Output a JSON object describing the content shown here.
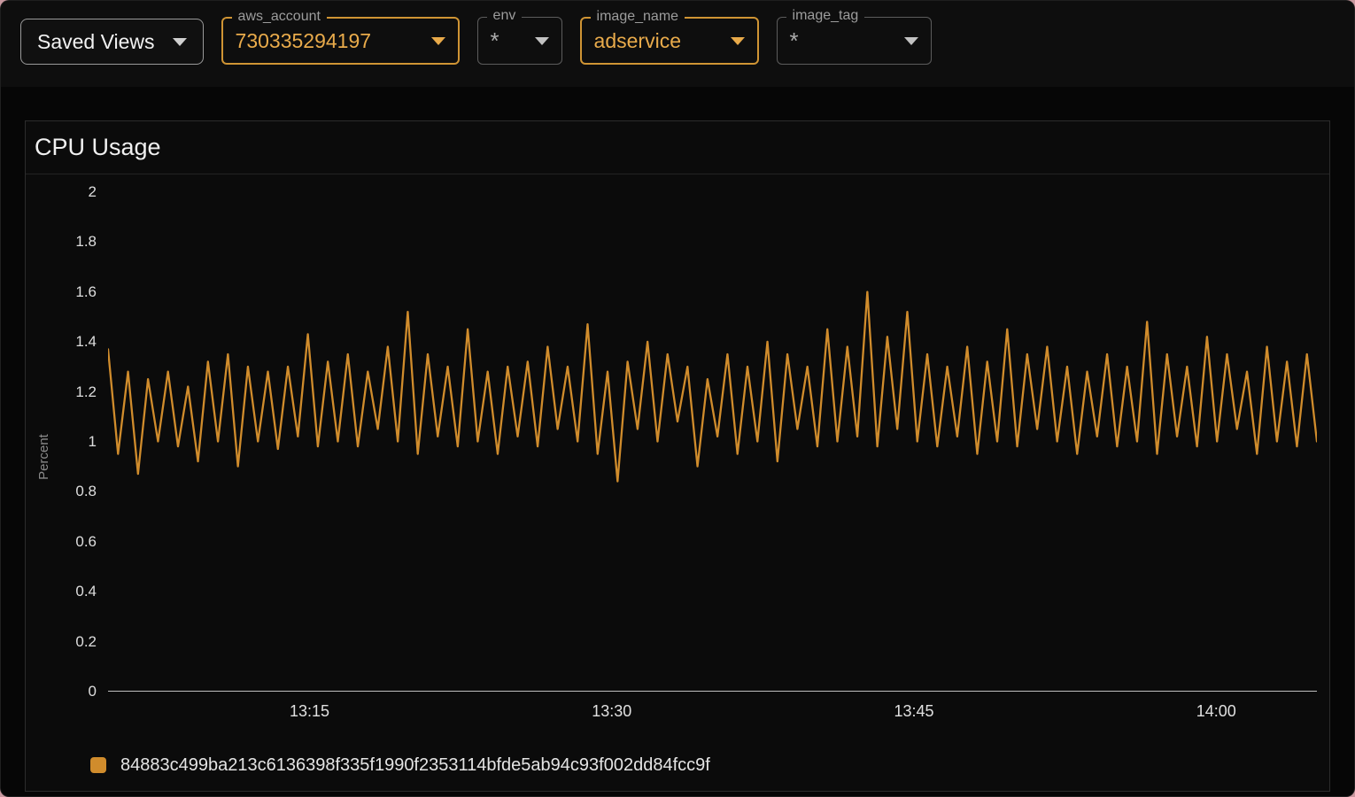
{
  "toolbar": {
    "saved_views_label": "Saved Views",
    "filters": [
      {
        "name": "aws_account",
        "value": "730335294197",
        "active": true
      },
      {
        "name": "env",
        "value": "*",
        "active": false
      },
      {
        "name": "image_name",
        "value": "adservice",
        "active": true
      },
      {
        "name": "image_tag",
        "value": "*",
        "active": false
      }
    ]
  },
  "panel": {
    "title": "CPU Usage"
  },
  "colors": {
    "accent_orange": "#e8aa4a",
    "line_orange": "#d08c2c",
    "filter_border_active": "#cf9434",
    "filter_border_inactive": "#5c5c5c"
  },
  "chart_data": {
    "type": "line",
    "title": "CPU Usage",
    "xlabel": "",
    "ylabel": "Percent",
    "ylim": [
      0,
      2
    ],
    "y_ticks": [
      0,
      0.2,
      0.4,
      0.6,
      0.8,
      1,
      1.2,
      1.4,
      1.6,
      1.8,
      2
    ],
    "x_start": "13:05",
    "x_end": "14:05",
    "x_ticks": [
      "13:15",
      "13:30",
      "13:45",
      "14:00"
    ],
    "interval_seconds": 30,
    "grid": false,
    "legend_position": "bottom",
    "series": [
      {
        "name": "84883c499ba213c6136398f335f1990f2353114bfde5ab94c93f002dd84fcc9f",
        "color": "#d08c2c",
        "values": [
          1.37,
          0.95,
          1.28,
          0.87,
          1.25,
          1.0,
          1.28,
          0.98,
          1.22,
          0.92,
          1.32,
          1.0,
          1.35,
          0.9,
          1.3,
          1.0,
          1.28,
          0.97,
          1.3,
          1.02,
          1.43,
          0.98,
          1.32,
          1.0,
          1.35,
          0.98,
          1.28,
          1.05,
          1.38,
          1.0,
          1.52,
          0.95,
          1.35,
          1.02,
          1.3,
          0.98,
          1.45,
          1.0,
          1.28,
          0.95,
          1.3,
          1.02,
          1.32,
          0.98,
          1.38,
          1.05,
          1.3,
          1.0,
          1.47,
          0.95,
          1.28,
          0.84,
          1.32,
          1.05,
          1.4,
          1.0,
          1.35,
          1.08,
          1.3,
          0.9,
          1.25,
          1.02,
          1.35,
          0.95,
          1.3,
          1.0,
          1.4,
          0.92,
          1.35,
          1.05,
          1.3,
          0.98,
          1.45,
          1.0,
          1.38,
          1.02,
          1.6,
          0.98,
          1.42,
          1.05,
          1.52,
          1.0,
          1.35,
          0.98,
          1.3,
          1.02,
          1.38,
          0.95,
          1.32,
          1.0,
          1.45,
          0.98,
          1.35,
          1.05,
          1.38,
          1.0,
          1.3,
          0.95,
          1.28,
          1.02,
          1.35,
          0.98,
          1.3,
          1.0,
          1.48,
          0.95,
          1.35,
          1.02,
          1.3,
          0.98,
          1.42,
          1.0,
          1.35,
          1.05,
          1.28,
          0.95,
          1.38,
          1.0,
          1.32,
          0.98,
          1.35,
          1.0
        ]
      }
    ]
  }
}
